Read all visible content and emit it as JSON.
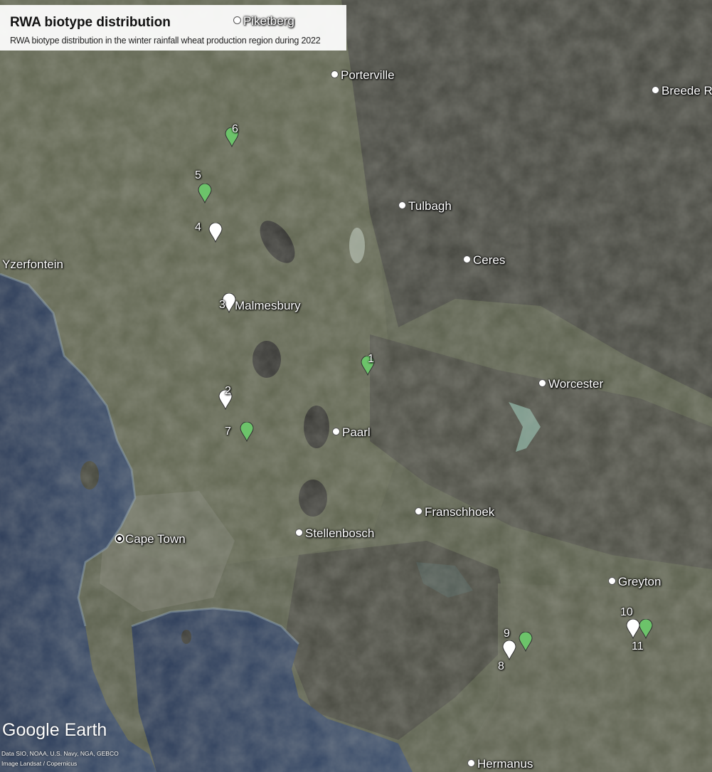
{
  "title": "RWA biotype distribution",
  "subtitle": "RWA biotype distribution in the winter rainfall wheat production region during 2022",
  "colors": {
    "green_marker": "#6cc36a",
    "white_marker": "#ffffff",
    "ocean": "#2f3f5c",
    "land": "#5a5f4c",
    "mountain": "#3d3d3a"
  },
  "places": [
    {
      "name": "Piketberg"
    },
    {
      "name": "Porterville"
    },
    {
      "name": "Breede R"
    },
    {
      "name": "Tulbagh"
    },
    {
      "name": "Ceres"
    },
    {
      "name": "Yzerfontein"
    },
    {
      "name": "Malmesbury"
    },
    {
      "name": "Worcester"
    },
    {
      "name": "Paarl"
    },
    {
      "name": "Franschhoek"
    },
    {
      "name": "Stellenbosch"
    },
    {
      "name": "Cape Town"
    },
    {
      "name": "Greyton"
    },
    {
      "name": "Hermanus"
    }
  ],
  "sites": [
    {
      "id": "1",
      "color": "green"
    },
    {
      "id": "2",
      "color": "white"
    },
    {
      "id": "3",
      "color": "white"
    },
    {
      "id": "4",
      "color": "white"
    },
    {
      "id": "5",
      "color": "green"
    },
    {
      "id": "6",
      "color": "green"
    },
    {
      "id": "7",
      "color": "green"
    },
    {
      "id": "8",
      "color": "white"
    },
    {
      "id": "9",
      "color": "green"
    },
    {
      "id": "10",
      "color": "white"
    },
    {
      "id": "11",
      "color": "green"
    }
  ],
  "watermark": {
    "brand1": "Google",
    "brand2": "Earth"
  },
  "credits": {
    "line1": "Data SIO, NOAA, U.S. Navy, NGA, GEBCO",
    "line2": "Image Landsat / Copernicus"
  }
}
